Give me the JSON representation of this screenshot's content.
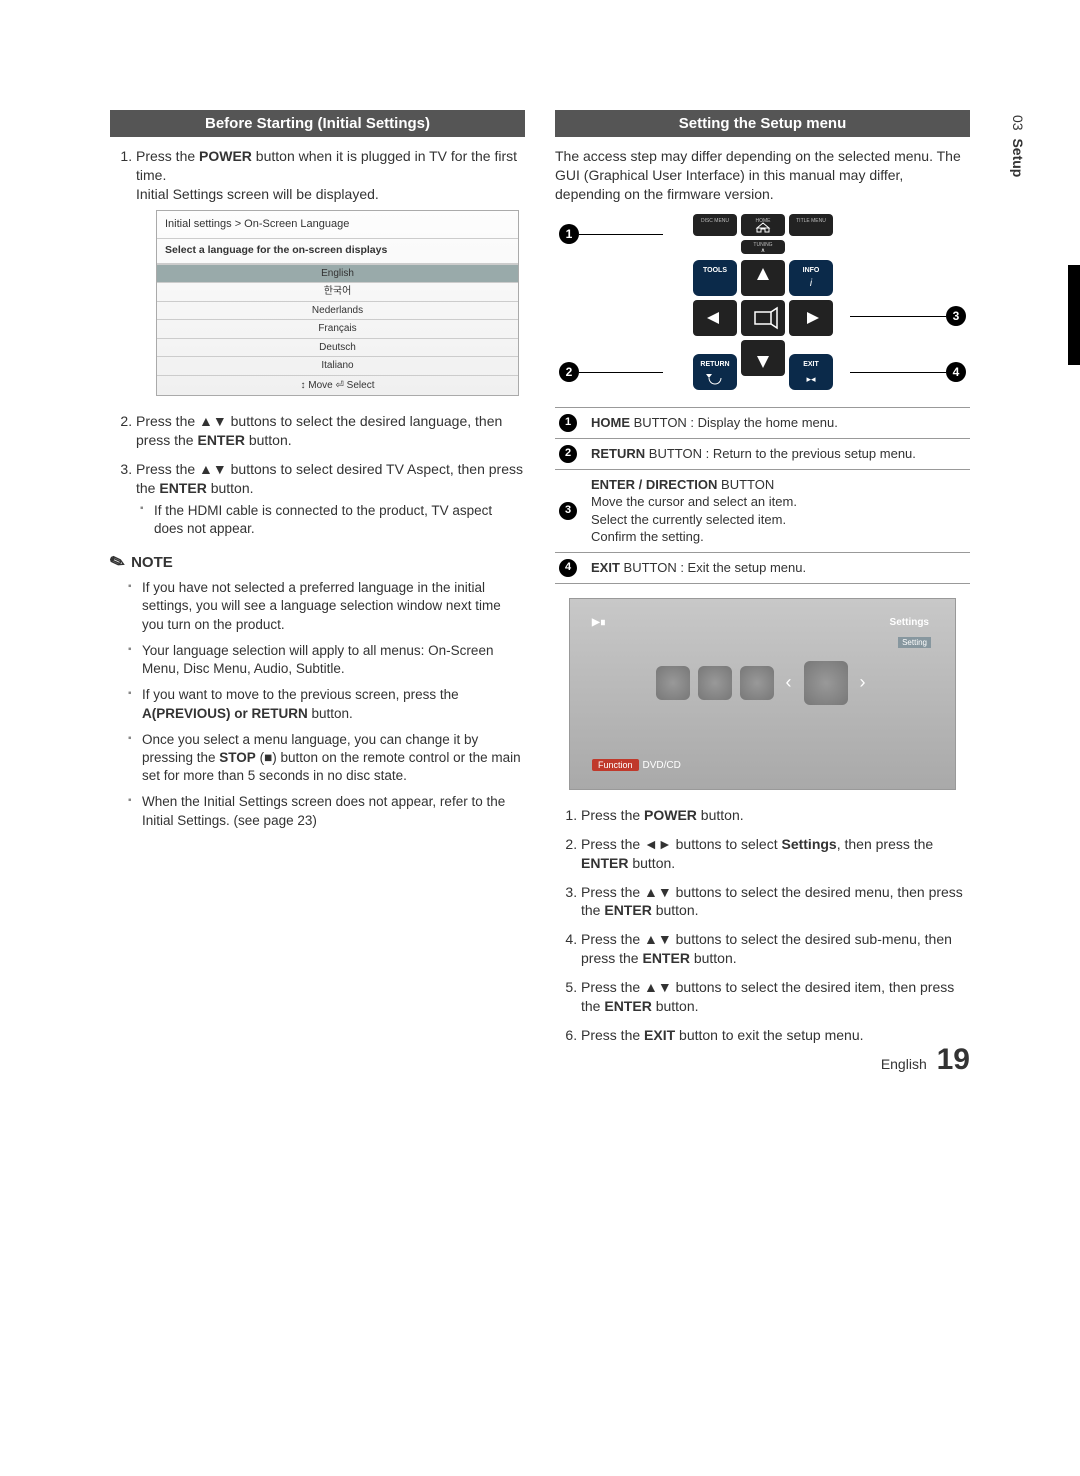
{
  "side": {
    "num": "03",
    "label": "Setup"
  },
  "left": {
    "header": "Before Starting (Initial Settings)",
    "step1_a": "Press the ",
    "step1_b": "POWER",
    "step1_c": " button when it is plugged in TV for the first time.",
    "step1_d": "Initial Settings screen will be displayed.",
    "langbox": {
      "breadcrumb": "Initial settings > On-Screen Language",
      "prompt": "Select a language for the on-screen displays",
      "items": [
        "English",
        "한국어",
        "Nederlands",
        "Français",
        "Deutsch",
        "Italiano"
      ],
      "foot": "↕ Move   ⏎ Select"
    },
    "step2_a": "Press the ▲▼ buttons to select the desired language, then press the ",
    "step2_b": "ENTER",
    "step2_c": " button.",
    "step3_a": "Press the ▲▼ buttons to select desired TV Aspect, then press the ",
    "step3_b": "ENTER",
    "step3_c": " button.",
    "step3_note": "If the HDMI cable is connected to the product, TV aspect does not appear.",
    "note_heading": "NOTE",
    "notes": [
      "If you have not selected a preferred language in the initial settings, you will see a language selection window next time you turn on the product.",
      "Your language selection will apply to all menus: On-Screen Menu, Disc Menu, Audio, Subtitle.",
      "If you want to move to the previous screen, press the A(PREVIOUS) or RETURN button.",
      "Once you select a menu language, you can change it by pressing the STOP (■) button on the remote control or the main set  for more than 5 seconds in no disc state.",
      "When the Initial Settings screen does not appear, refer to the Initial Settings. (see page 23)"
    ],
    "note3_bold": "A(PREVIOUS) or RETURN",
    "note4_bold": "STOP"
  },
  "right": {
    "header": "Setting the Setup menu",
    "intro": "The access step may differ depending on the selected menu. The GUI (Graphical User Interface) in this manual may differ, depending on the firmware version.",
    "remote": {
      "top_labels": {
        "disc": "DISC MENU",
        "home": "HOME",
        "title": "TITLE MENU"
      },
      "tuning": "TUNING",
      "tools": "TOOLS",
      "info": "INFO",
      "return": "RETURN",
      "exit": "EXIT"
    },
    "buttons": [
      {
        "n": "1",
        "bold": "HOME",
        "rest": " BUTTON : Display the home menu."
      },
      {
        "n": "2",
        "bold": "RETURN",
        "rest": " BUTTON : Return to the previous setup menu."
      },
      {
        "n": "3",
        "bold": "ENTER / DIRECTION",
        "rest": " BUTTON",
        "extra": "Move the cursor and select an item.\nSelect the currently selected item.\nConfirm the setting."
      },
      {
        "n": "4",
        "bold": "EXIT",
        "rest": " BUTTON : Exit the setup menu."
      }
    ],
    "tv": {
      "topleft": "▶∎",
      "settings": "Settings",
      "tip": "Setting",
      "func_chip": "Function",
      "func_text": "DVD/CD"
    },
    "steps": [
      {
        "a": "Press the ",
        "b": "POWER",
        "c": " button."
      },
      {
        "a": "Press the ◄► buttons to select ",
        "b": "Settings",
        "c": ", then press the ",
        "d": "ENTER",
        "e": " button."
      },
      {
        "a": "Press the ▲▼ buttons to select the desired menu, then press the ",
        "b": "ENTER",
        "c": " button."
      },
      {
        "a": "Press the ▲▼ buttons to select the desired sub-menu, then press the ",
        "b": "ENTER",
        "c": " button."
      },
      {
        "a": "Press the ▲▼ buttons to select the desired item, then press the ",
        "b": "ENTER",
        "c": " button."
      },
      {
        "a": "Press the ",
        "b": "EXIT",
        "c": " button to exit the setup menu."
      }
    ]
  },
  "footer": {
    "lang": "English",
    "page": "19"
  }
}
